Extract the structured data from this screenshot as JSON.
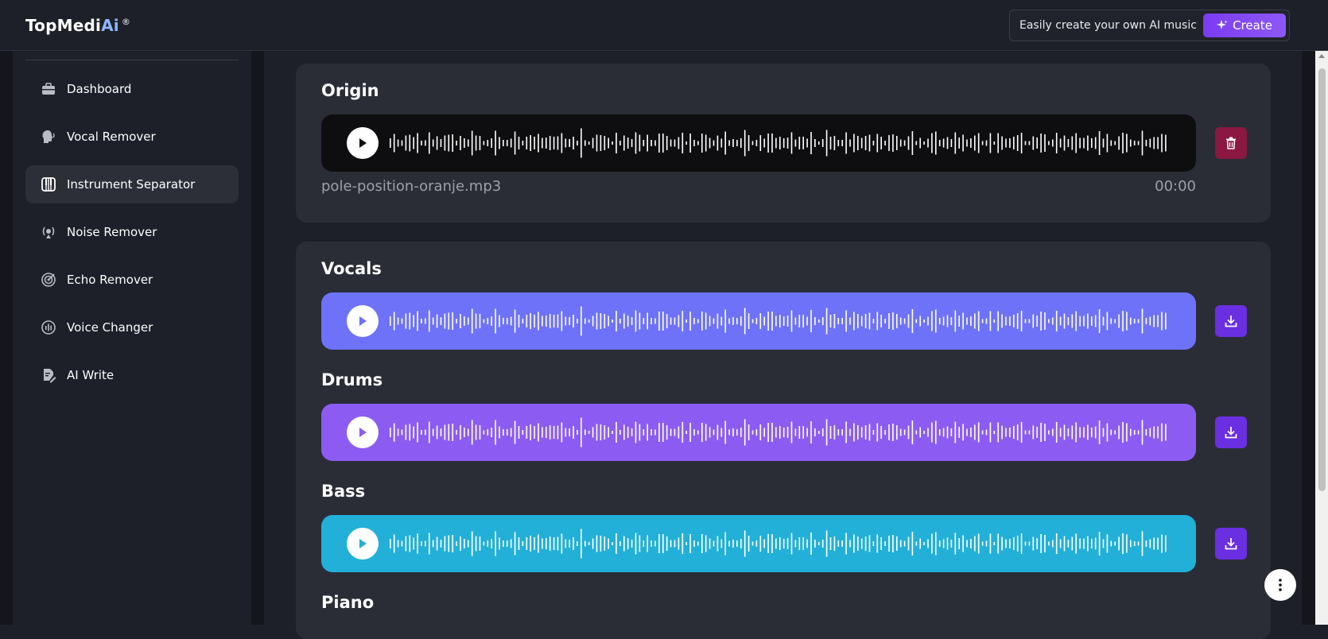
{
  "header": {
    "logo_main": "TopMedi",
    "logo_ai": "Ai",
    "logo_reg": "®",
    "promo_text": "Easily create your own AI music",
    "create_label": "Create"
  },
  "sidebar": {
    "items": [
      {
        "label": "Dashboard",
        "icon": "briefcase-icon"
      },
      {
        "label": "Vocal Remover",
        "icon": "head-voice-icon"
      },
      {
        "label": "Instrument Separator",
        "icon": "piano-icon",
        "active": true
      },
      {
        "label": "Noise Remover",
        "icon": "noise-icon"
      },
      {
        "label": "Echo Remover",
        "icon": "echo-icon"
      },
      {
        "label": "Voice Changer",
        "icon": "voice-changer-icon"
      },
      {
        "label": "AI Write",
        "icon": "document-edit-icon"
      }
    ]
  },
  "origin": {
    "title": "Origin",
    "file_name": "pole-position-oranje.mp3",
    "time": "00:00",
    "player_color": "#0e0e10",
    "delete_color": "#8a1840"
  },
  "tracks": [
    {
      "title": "Vocals",
      "color": "#6e72f9"
    },
    {
      "title": "Drums",
      "color": "#8c5cf2"
    },
    {
      "title": "Bass",
      "color": "#22b0d8"
    },
    {
      "title": "Piano",
      "color": "#6e72f9"
    }
  ],
  "colors": {
    "download_btn": "#6a2fe0",
    "play_icon_origin": "#111111"
  }
}
